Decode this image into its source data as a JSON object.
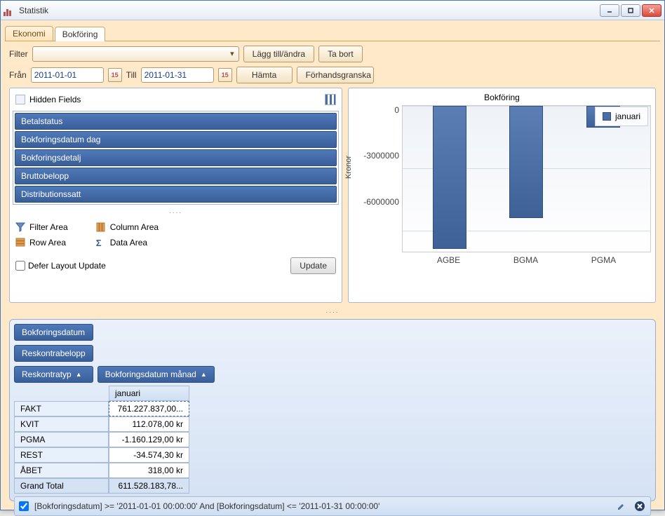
{
  "window": {
    "title": "Statistik"
  },
  "tabs": {
    "ekonomi": "Ekonomi",
    "bokforing": "Bokföring"
  },
  "filter": {
    "label": "Filter",
    "add_edit": "Lägg till/ändra",
    "remove": "Ta bort"
  },
  "date": {
    "from_label": "Från",
    "from_value": "2011-01-01",
    "to_label": "Till",
    "to_value": "2011-01-31",
    "cal_day": "15",
    "fetch": "Hämta",
    "preview": "Förhandsgranska"
  },
  "hidden_fields": {
    "heading": "Hidden Fields",
    "items": [
      "Betalstatus",
      "Bokforingsdatum dag",
      "Bokforingsdetalj",
      "Bruttobelopp",
      "Distributionssatt"
    ]
  },
  "areas": {
    "filter": "Filter Area",
    "row": "Row Area",
    "column": "Column Area",
    "data": "Data Area"
  },
  "defer": {
    "label": "Defer Layout Update",
    "update": "Update"
  },
  "chart_data": {
    "type": "bar",
    "title": "Bokföring",
    "ylabel": "Kronor",
    "ylim": [
      -7000000,
      0
    ],
    "yticks": [
      0,
      -3000000,
      -6000000
    ],
    "categories": [
      "AGBE",
      "BGMA",
      "PGMA"
    ],
    "series": [
      {
        "name": "januari",
        "values": [
          -6900000,
          -5400000,
          -1050000
        ]
      }
    ],
    "legend_position": "right"
  },
  "pivot": {
    "row_field_chip": "Bokforingsdatum",
    "data_field_chip": "Reskontrabelopp",
    "row_axis_chip": "Reskontratyp",
    "col_axis_chip": "Bokforingsdatum månad",
    "col_header": "januari",
    "rows": [
      {
        "label": "FAKT",
        "value": "761.227.837,00..."
      },
      {
        "label": "KVIT",
        "value": "112.078,00 kr"
      },
      {
        "label": "PGMA",
        "value": "-1.160.129,00 kr"
      },
      {
        "label": "REST",
        "value": "-34.574,30 kr"
      },
      {
        "label": "ÅBET",
        "value": "318,00 kr"
      }
    ],
    "grand_total": {
      "label": "Grand Total",
      "value": "611.528.183,78..."
    }
  },
  "footer_filter": {
    "text": "[Bokforingsdatum] >= '2011-01-01 00:00:00' And [Bokforingsdatum] <= '2011-01-31 00:00:00'"
  }
}
